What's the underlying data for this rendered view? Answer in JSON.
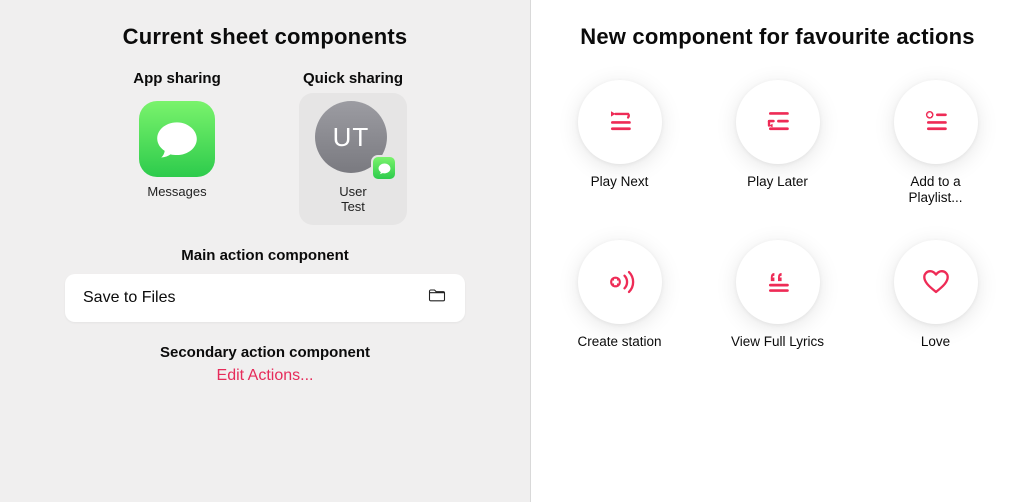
{
  "left": {
    "title": "Current sheet components",
    "app_sharing_title": "App sharing",
    "quick_sharing_title": "Quick sharing",
    "app_sharing": {
      "label": "Messages"
    },
    "quick_sharing": {
      "initials": "UT",
      "label": "User\nTest"
    },
    "main_action_title": "Main action component",
    "main_action_label": "Save to Files",
    "secondary_title": "Secondary action component",
    "secondary_label": "Edit Actions..."
  },
  "right": {
    "title": "New component for favourite actions",
    "items": [
      {
        "label": "Play Next"
      },
      {
        "label": "Play Later"
      },
      {
        "label": "Add to a Playlist..."
      },
      {
        "label": "Create station"
      },
      {
        "label": "View Full Lyrics"
      },
      {
        "label": "Love"
      }
    ]
  },
  "colors": {
    "accent_pink": "#ee2b56"
  }
}
